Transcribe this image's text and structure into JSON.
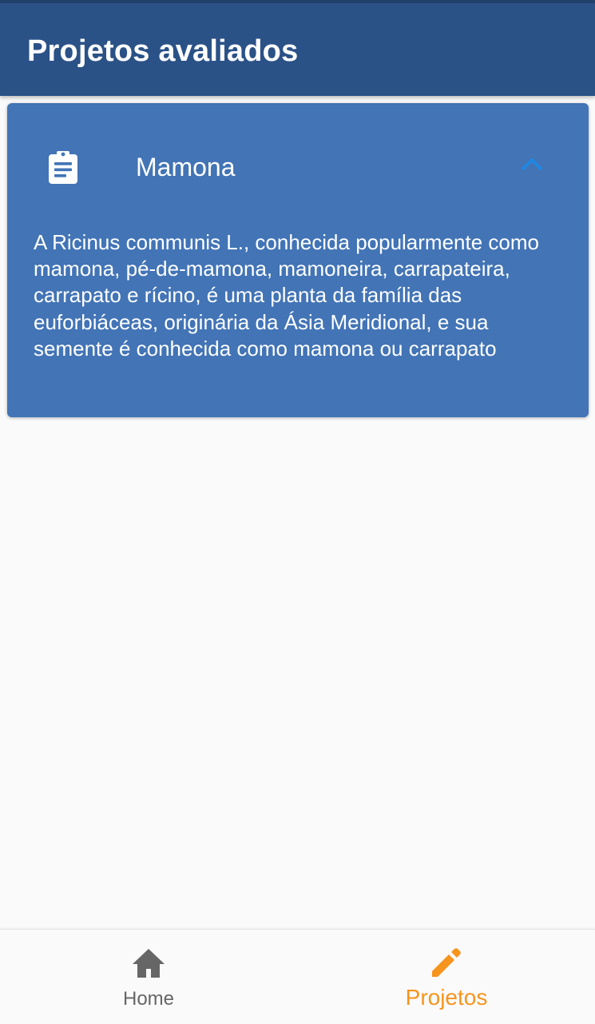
{
  "app_bar": {
    "title": "Projetos avaliados"
  },
  "project_card": {
    "title": "Mamona",
    "description": "A Ricinus communis L., conhecida popularmente como mamona, pé-de-mamona, mamoneira, carrapateira, carrapato e rícino, é uma planta da família das euforbiáceas, originária da Ásia Meridional, e sua semente é conhecida como mamona ou carrapato",
    "expanded": true,
    "leading_icon": "clipboard-icon",
    "toggle_icon": "chevron-up-icon"
  },
  "bottom_nav": {
    "items": [
      {
        "label": "Home",
        "icon": "home-icon",
        "selected": false
      },
      {
        "label": "Projetos",
        "icon": "pencil-icon",
        "selected": true
      }
    ]
  },
  "colors": {
    "app_bar": "#2b5287",
    "card": "#4274b6",
    "accent": "#f7941d",
    "chevron": "#1e88e5",
    "inactive_nav": "#666666",
    "background": "#fafafa"
  }
}
